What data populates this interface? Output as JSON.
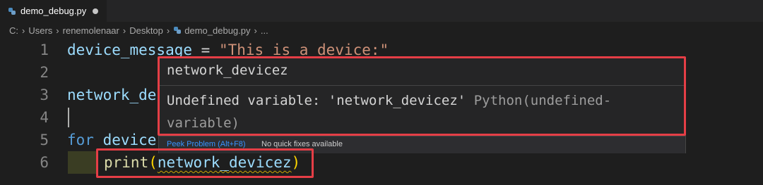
{
  "tab": {
    "filename": "demo_debug.py"
  },
  "breadcrumb": [
    "C:",
    "Users",
    "renemolenaar",
    "Desktop",
    "demo_debug.py",
    "..."
  ],
  "code": [
    {
      "n": "1",
      "text": "device_message = \"This is a device:\""
    },
    {
      "n": "2",
      "text": ""
    },
    {
      "n": "3",
      "text": "network_de"
    },
    {
      "n": "4",
      "text": ""
    },
    {
      "n": "5",
      "text": "for device"
    },
    {
      "n": "6",
      "text": "print(network_devicez)"
    }
  ],
  "tokens": {
    "l1_var": "device_message",
    "l1_eq": " = ",
    "l1_str": "\"This is a device:\"",
    "l3": "network_de",
    "l5_kw": "for",
    "l5_rest": " device",
    "l6_fn": "print",
    "l6_open": "(",
    "l6_arg": "network_devicez",
    "l6_close": ")"
  },
  "hover": {
    "title": "network_devicez",
    "message": "Undefined variable: 'network_devicez'",
    "source": "Python(undefined-variable)",
    "source_part1": "Python(undefined-",
    "source_part2": "variable)",
    "peek_label": "Peek Problem (Alt+F8)",
    "no_fix_label": "No quick fixes available"
  },
  "colors": {
    "background": "#1e1e1e",
    "string": "#ce9178",
    "keyword": "#569cd6",
    "function": "#dcdcaa",
    "highlight_box": "#e53e46",
    "link": "#3794ff"
  }
}
